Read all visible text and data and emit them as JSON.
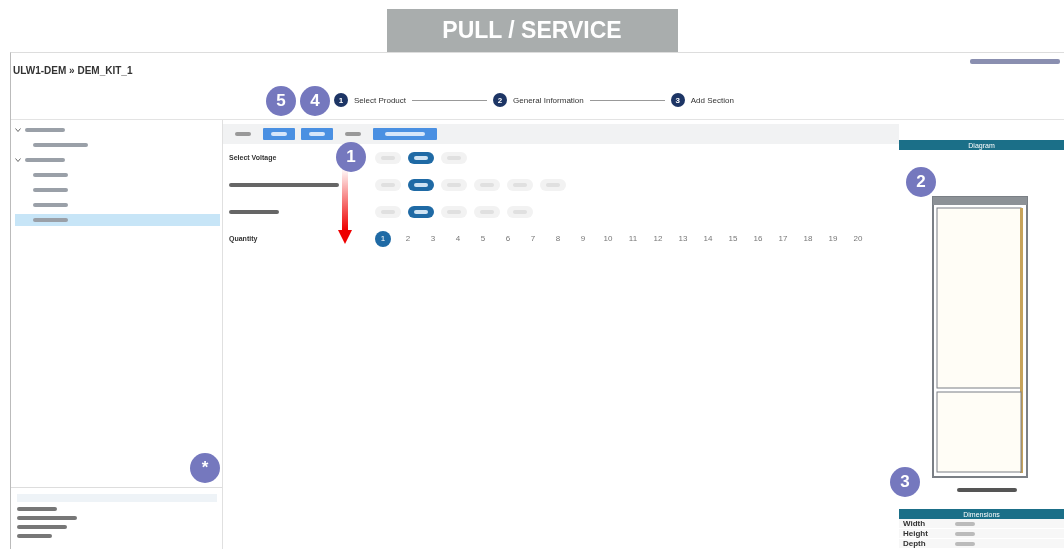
{
  "banner": {
    "title": "PULL / SERVICE"
  },
  "header": {
    "title": "ULW1-DEM » DEM_KIT_1"
  },
  "steps": [
    {
      "number": "1",
      "label": "Select Product"
    },
    {
      "number": "2",
      "label": "General Information"
    },
    {
      "number": "3",
      "label": "Add Section"
    }
  ],
  "tree": [
    {
      "expanded": true,
      "selected": false,
      "children": [
        {
          "selected": false
        }
      ]
    },
    {
      "expanded": true,
      "selected": false,
      "children": [
        {
          "selected": false
        },
        {
          "selected": false
        },
        {
          "selected": false
        },
        {
          "selected": true
        }
      ]
    }
  ],
  "toolbar": [
    {
      "kind": "plain"
    },
    {
      "kind": "primary"
    },
    {
      "kind": "primary"
    },
    {
      "kind": "plain"
    },
    {
      "kind": "dropdown"
    }
  ],
  "options": [
    {
      "label": "Select Voltage",
      "choices": [
        {
          "selected": false
        },
        {
          "selected": true
        },
        {
          "selected": false
        }
      ]
    },
    {
      "choices": [
        {
          "selected": false
        },
        {
          "selected": true
        },
        {
          "selected": false
        },
        {
          "selected": false
        },
        {
          "selected": false
        },
        {
          "selected": false
        }
      ]
    },
    {
      "choices": [
        {
          "selected": false
        },
        {
          "selected": true
        },
        {
          "selected": false
        },
        {
          "selected": false
        },
        {
          "selected": false
        }
      ]
    },
    {
      "label": "Quantity",
      "choices": [
        {
          "label": "1",
          "selected": true
        },
        {
          "label": "2",
          "selected": false
        },
        {
          "label": "3",
          "selected": false
        },
        {
          "label": "4",
          "selected": false
        },
        {
          "label": "5",
          "selected": false
        },
        {
          "label": "6",
          "selected": false
        },
        {
          "label": "7",
          "selected": false
        },
        {
          "label": "8",
          "selected": false
        },
        {
          "label": "9",
          "selected": false
        },
        {
          "label": "10",
          "selected": false
        },
        {
          "label": "11",
          "selected": false
        },
        {
          "label": "12",
          "selected": false
        },
        {
          "label": "13",
          "selected": false
        },
        {
          "label": "14",
          "selected": false
        },
        {
          "label": "15",
          "selected": false
        },
        {
          "label": "16",
          "selected": false
        },
        {
          "label": "17",
          "selected": false
        },
        {
          "label": "18",
          "selected": false
        },
        {
          "label": "19",
          "selected": false
        },
        {
          "label": "20",
          "selected": false
        }
      ]
    }
  ],
  "diagram": {
    "title": "Diagram"
  },
  "dimensions": {
    "title": "Dimensions",
    "rows": [
      {
        "label": "Width"
      },
      {
        "label": "Height"
      },
      {
        "label": "Depth"
      }
    ]
  },
  "summary": {
    "lines": [
      {
        "kind": "blurred"
      },
      {
        "kind": "blurred"
      },
      {
        "kind": "blurred"
      },
      {
        "kind": "blurred"
      }
    ]
  },
  "callouts": [
    {
      "label": "5"
    },
    {
      "label": "4"
    },
    {
      "label": "1"
    },
    {
      "label": "2"
    },
    {
      "label": "3"
    },
    {
      "label": "*"
    }
  ]
}
